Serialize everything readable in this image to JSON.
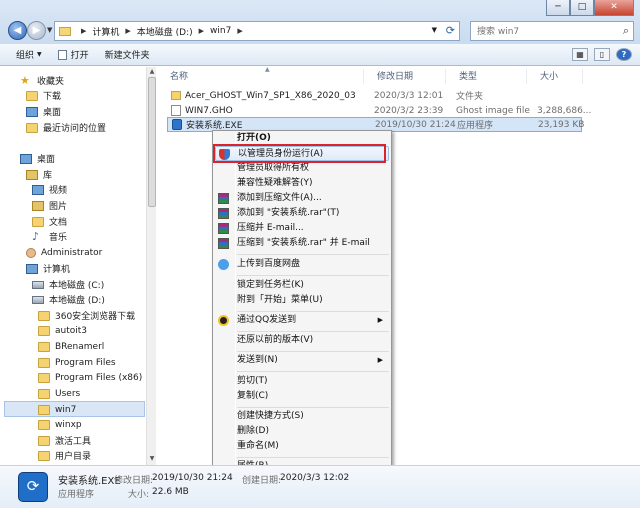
{
  "window": {
    "minimize": "─",
    "maximize": "□",
    "close": "✕"
  },
  "address": {
    "crumbs": [
      "计算机",
      "本地磁盘 (D:)",
      "win7"
    ]
  },
  "search": {
    "placeholder": "搜索 win7"
  },
  "toolbar": {
    "organize": "组织",
    "open": "打开",
    "new_folder": "新建文件夹"
  },
  "nav": {
    "items": [
      {
        "label": "收藏夹",
        "icon": "star-icon"
      },
      {
        "label": "下载",
        "icon": "folder-icon"
      },
      {
        "label": "桌面",
        "icon": "desktop-icon"
      },
      {
        "label": "最近访问的位置",
        "icon": "recent-icon"
      },
      {
        "label": "桌面",
        "icon": "desktop-icon"
      },
      {
        "label": "库",
        "icon": "library-icon"
      },
      {
        "label": "视频",
        "icon": "video-icon"
      },
      {
        "label": "图片",
        "icon": "picture-icon"
      },
      {
        "label": "文档",
        "icon": "document-icon"
      },
      {
        "label": "音乐",
        "icon": "music-icon"
      },
      {
        "label": "Administrator",
        "icon": "user-icon"
      },
      {
        "label": "计算机",
        "icon": "computer-icon"
      },
      {
        "label": "本地磁盘 (C:)",
        "icon": "drive-icon"
      },
      {
        "label": "本地磁盘 (D:)",
        "icon": "drive-icon"
      },
      {
        "label": "360安全浏览器下载",
        "icon": "folder-icon"
      },
      {
        "label": "autoit3",
        "icon": "folder-icon"
      },
      {
        "label": "BRenamerl",
        "icon": "folder-icon"
      },
      {
        "label": "Program Files",
        "icon": "folder-icon"
      },
      {
        "label": "Program Files (x86)",
        "icon": "folder-icon"
      },
      {
        "label": "Users",
        "icon": "folder-icon"
      },
      {
        "label": "win7",
        "icon": "folder-icon"
      },
      {
        "label": "winxp",
        "icon": "folder-icon"
      },
      {
        "label": "激活工具",
        "icon": "folder-icon"
      },
      {
        "label": "用户目录",
        "icon": "folder-icon"
      }
    ]
  },
  "columns": {
    "name": "名称",
    "date": "修改日期",
    "type": "类型",
    "size": "大小"
  },
  "files": [
    {
      "name": "Acer_GHOST_Win7_SP1_X86_2020_03",
      "date": "2020/3/3 12:01",
      "type": "文件夹",
      "size": ""
    },
    {
      "name": "WIN7.GHO",
      "date": "2020/3/2 23:39",
      "type": "Ghost image file",
      "size": "3,288,686..."
    },
    {
      "name": "安装系统.EXE",
      "date": "2019/10/30 21:24",
      "type": "应用程序",
      "size": "23,193 KB"
    }
  ],
  "menu": {
    "open": "打开(O)",
    "run_as_admin": "以管理员身份运行(A)",
    "take_ownership": "管理员取得所有权",
    "compat": "兼容性疑难解答(Y)",
    "add_archive": "添加到压缩文件(A)...",
    "add_rar": "添加到 \"安装系统.rar\"(T)",
    "compress_email": "压缩并 E-mail...",
    "compress_rar_email": "压缩到 \"安装系统.rar\" 并 E-mail",
    "baidu": "上传到百度网盘",
    "pin_taskbar": "锁定到任务栏(K)",
    "pin_start": "附到「开始」菜单(U)",
    "qq_send": "通过QQ发送到",
    "restore": "还原以前的版本(V)",
    "send_to": "发送到(N)",
    "cut": "剪切(T)",
    "copy": "复制(C)",
    "shortcut": "创建快捷方式(S)",
    "delete": "删除(D)",
    "rename": "重命名(M)",
    "properties": "属性(R)"
  },
  "details": {
    "name": "安装系统.EXE",
    "modified_label": "修改日期:",
    "modified": "2019/10/30 21:24",
    "created_label": "创建日期:",
    "created": "2020/3/3 12:02",
    "type": "应用程序",
    "size_label": "大小:",
    "size": "22.6 MB"
  },
  "colors": {
    "highlight": "#d9242b",
    "selection": "#d4e5f8"
  }
}
